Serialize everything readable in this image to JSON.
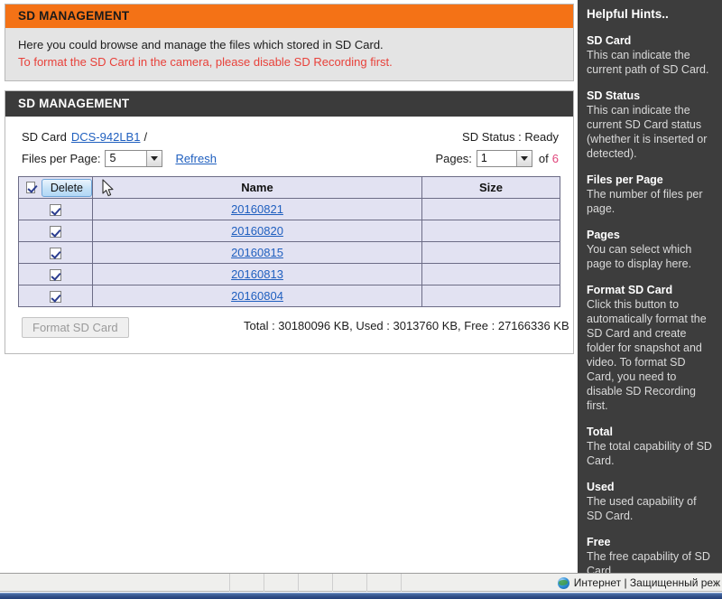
{
  "intro": {
    "title": "SD MANAGEMENT",
    "line1": "Here you could browse and manage the files which stored in SD Card.",
    "line2": "To format the SD Card in the camera, please disable SD Recording first.",
    "warn_color": "#e8413a",
    "header_color": "#f47216"
  },
  "panel": {
    "title": "SD MANAGEMENT",
    "header_color": "#3b3b3b"
  },
  "controls": {
    "sd_card_label": "SD Card",
    "sd_card_path": "DCS-942LB1",
    "path_separator": "/",
    "sd_status_label": "SD Status : Ready",
    "files_per_page_label": "Files per Page:",
    "files_per_page_value": "5",
    "refresh_label": "Refresh",
    "pages_label": "Pages:",
    "pages_value": "1",
    "of_label": "of",
    "pages_total": "6",
    "pages_total_color": "#e0457b"
  },
  "table": {
    "headers": {
      "name": "Name",
      "size": "Size"
    },
    "select_all_checked": true,
    "delete_label": "Delete",
    "rows": [
      {
        "checked": true,
        "name": "20160821",
        "size": ""
      },
      {
        "checked": true,
        "name": "20160820",
        "size": ""
      },
      {
        "checked": true,
        "name": "20160815",
        "size": ""
      },
      {
        "checked": true,
        "name": "20160813",
        "size": ""
      },
      {
        "checked": true,
        "name": "20160804",
        "size": ""
      }
    ]
  },
  "footer": {
    "format_button": "Format SD Card",
    "totals": "Total : 30180096 KB, Used : 3013760 KB, Free : 27166336 KB"
  },
  "hints": {
    "title": "Helpful Hints..",
    "items": [
      {
        "heading": "SD Card",
        "text": "This can indicate the current path of SD Card."
      },
      {
        "heading": "SD Status",
        "text": "This can indicate the current SD Card status (whether it is inserted or detected)."
      },
      {
        "heading": "Files per Page",
        "text": "The number of files per page."
      },
      {
        "heading": "Pages",
        "text": "You can select which page to display here."
      },
      {
        "heading": "Format SD Card",
        "text": "Click this button to automatically format the SD Card and create folder for snapshot and video. To format SD Card, you need to disable SD Recording first."
      },
      {
        "heading": "Total",
        "text": "The total capability of SD Card."
      },
      {
        "heading": "Used",
        "text": "The used capability of SD Card."
      },
      {
        "heading": "Free",
        "text": "The free capability of SD Card."
      }
    ]
  },
  "statusbar": {
    "zone_text": "Интернет | Защищенный реж"
  }
}
